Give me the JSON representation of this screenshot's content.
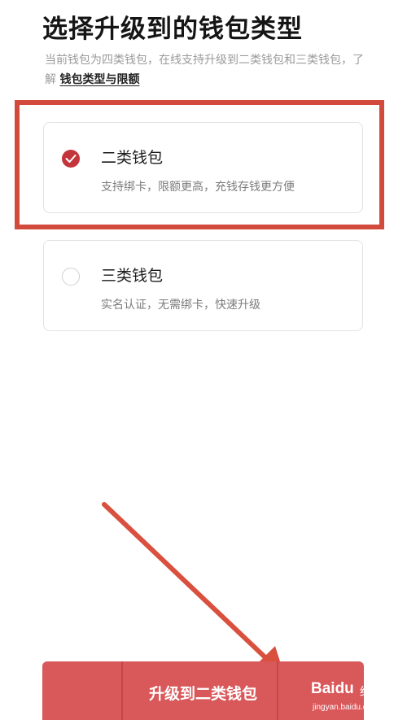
{
  "header": {
    "title": "选择升级到的钱包类型",
    "intro_text": "当前钱包为四类钱包，在线支持升级到二类钱包和三类钱包，了解 ",
    "intro_link": "钱包类型与限额"
  },
  "options": [
    {
      "title": "二类钱包",
      "desc": "支持绑卡，限额更高，充钱存钱更方便",
      "selected": true
    },
    {
      "title": "三类钱包",
      "desc": "实名认证，无需绑卡，快速升级",
      "selected": false
    }
  ],
  "footer": {
    "upgrade_label": "升级到二类钱包"
  },
  "annotation": {
    "highlight_color": "#d24a3c",
    "arrow_color": "#d9503f"
  },
  "watermark": {
    "logo": "Baidu",
    "cn": "经验",
    "url": "jingyan.baidu.com"
  },
  "colors": {
    "accent": "#c4343b",
    "button": "#d9585a"
  }
}
